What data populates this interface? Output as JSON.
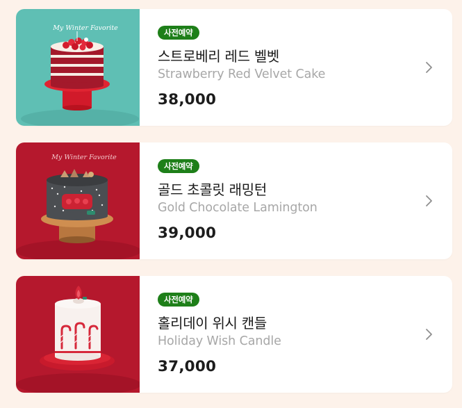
{
  "colors": {
    "page_bg": "#fdf2ea",
    "badge": "#1e7f19"
  },
  "products": [
    {
      "badge": "사전예약",
      "name_ko": "스트로베리 레드 벨벳",
      "name_en": "Strawberry Red Velvet Cake",
      "price": "38,000",
      "thumb_bg": "#5fbfb4",
      "topper_text": "My Winter Favorite"
    },
    {
      "badge": "사전예약",
      "name_ko": "골드 초콜릿 래밍턴",
      "name_en": "Gold Chocolate Lamington",
      "price": "39,000",
      "thumb_bg": "#b5182d",
      "topper_text": "My Winter Favorite"
    },
    {
      "badge": "사전예약",
      "name_ko": "홀리데이 위시 캔들",
      "name_en": "Holiday Wish Candle",
      "price": "37,000",
      "thumb_bg": "#b5182d"
    }
  ]
}
